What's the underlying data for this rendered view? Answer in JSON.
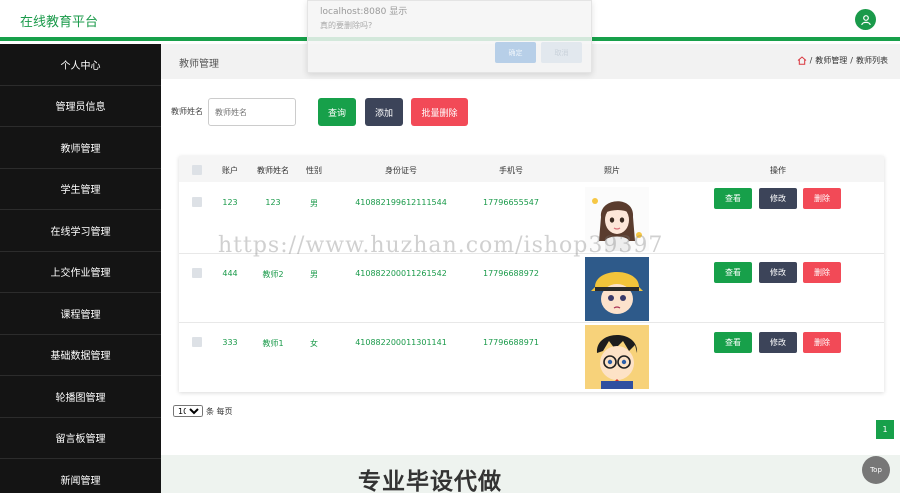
{
  "app": {
    "title": "在线教育平台"
  },
  "colors": {
    "brand": "#17a04a",
    "sidebar": "#141414",
    "danger": "#f24a57",
    "dark_button": "#3c4459"
  },
  "sidebar": {
    "items": [
      {
        "label": "个人中心"
      },
      {
        "label": "管理员信息"
      },
      {
        "label": "教师管理"
      },
      {
        "label": "学生管理"
      },
      {
        "label": "在线学习管理"
      },
      {
        "label": "上交作业管理"
      },
      {
        "label": "课程管理"
      },
      {
        "label": "基础数据管理"
      },
      {
        "label": "轮播图管理"
      },
      {
        "label": "留言板管理"
      },
      {
        "label": "新闻管理"
      }
    ]
  },
  "page": {
    "title": "教师管理",
    "breadcrumb": {
      "sep": "/",
      "item1": "教师管理",
      "item2": "教师列表"
    }
  },
  "search": {
    "label": "教师姓名",
    "placeholder": "教师姓名",
    "query_btn": "查询",
    "add_btn": "添加",
    "batch_delete_btn": "批量删除"
  },
  "table": {
    "headers": {
      "account": "账户",
      "name": "教师姓名",
      "gender": "性别",
      "id_card": "身份证号",
      "phone": "手机号",
      "photo": "照片",
      "ops": "操作"
    },
    "rows": [
      {
        "account": "123",
        "name": "123",
        "gender": "男",
        "id_card": "410882199612111544",
        "phone": "17796655547",
        "view": "查看",
        "edit": "修改",
        "delete": "删除"
      },
      {
        "account": "444",
        "name": "教师2",
        "gender": "男",
        "id_card": "410882200011261542",
        "phone": "17796688972",
        "view": "查看",
        "edit": "修改",
        "delete": "删除"
      },
      {
        "account": "333",
        "name": "教师1",
        "gender": "女",
        "id_card": "410882200011301141",
        "phone": "17796688971",
        "view": "查看",
        "edit": "修改",
        "delete": "删除"
      }
    ]
  },
  "pagination": {
    "page_size": "10",
    "per_page_label": "条 每页",
    "current_page": "1"
  },
  "overlay": {
    "banner": "专业毕设代做",
    "top_btn": "Top",
    "watermark": "https://www.huzhan.com/ishop39397"
  },
  "dialog": {
    "title": "localhost:8080 显示",
    "message": "真的要删除吗?",
    "ok": "确定",
    "cancel": "取消"
  }
}
